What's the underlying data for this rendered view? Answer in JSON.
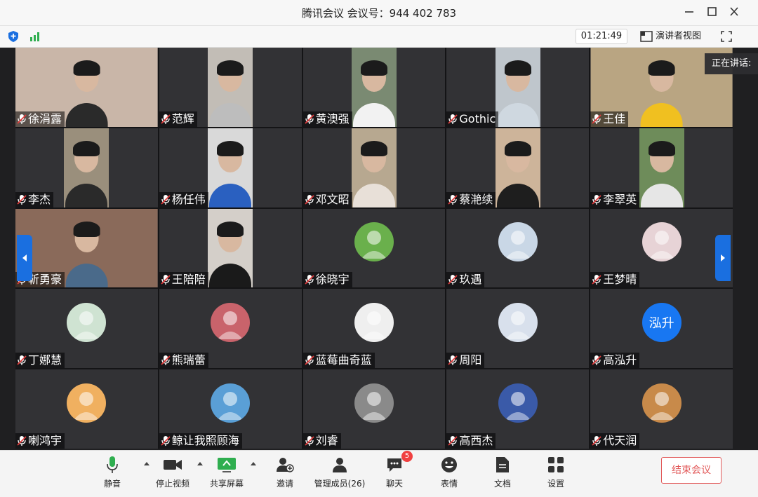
{
  "window": {
    "title": "腾讯会议 会议号：944 402 783",
    "timer": "01:21:49",
    "speaker_view": "演讲者视图",
    "speaking_tip": "正在讲话: "
  },
  "colors": {
    "accent": "#1a6fe0",
    "end": "#e25a5a",
    "badge": "#f04040"
  },
  "participants": [
    {
      "name": "徐涓露",
      "kind": "video",
      "wide": true,
      "bg": "#c9b6a8",
      "shirt": "#2a2a2a"
    },
    {
      "name": "范辉",
      "kind": "video",
      "bg": "#c2bdb6",
      "shirt": "#bdbdbd"
    },
    {
      "name": "黄澳强",
      "kind": "video",
      "bg": "#7a8a72",
      "shirt": "#f2f2f2"
    },
    {
      "name": "Gothic",
      "kind": "video",
      "bg": "#bfc6cc",
      "shirt": "#cfd8e0"
    },
    {
      "name": "王佳",
      "kind": "video",
      "wide": true,
      "bg": "#b9a582",
      "shirt": "#f0c020"
    },
    {
      "name": "李杰",
      "kind": "video",
      "bg": "#9a8f7c",
      "shirt": "#2a2a2a"
    },
    {
      "name": "杨任伟",
      "kind": "video",
      "bg": "#d9d9d9",
      "shirt": "#2a60c0"
    },
    {
      "name": "邓文昭",
      "kind": "video",
      "bg": "#b7a890",
      "shirt": "#e8e0d8"
    },
    {
      "name": "蔡滟续",
      "kind": "video",
      "bg": "#cdb49a",
      "shirt": "#1e1e1e"
    },
    {
      "name": "李翠英",
      "kind": "video",
      "bg": "#6e8c5a",
      "shirt": "#e6e6e6"
    },
    {
      "name": "靳勇豪",
      "kind": "video",
      "wide": true,
      "bg": "#8a6a5a",
      "shirt": "#4a6a8a"
    },
    {
      "name": "王陪陪",
      "kind": "video",
      "bg": "#d4cfc9",
      "shirt": "#1a1a1a"
    },
    {
      "name": "徐晓宇",
      "kind": "avatar",
      "avatar": "green-bird",
      "color": "#6ab04c"
    },
    {
      "name": "玖遇",
      "kind": "avatar",
      "avatar": "anime-girl",
      "color": "#c9d7e6"
    },
    {
      "name": "王梦晴",
      "kind": "avatar",
      "avatar": "anime-girl",
      "color": "#e7d3d6"
    },
    {
      "name": "丁娜慧",
      "kind": "avatar",
      "avatar": "illustration",
      "color": "#cfe3d2"
    },
    {
      "name": "熊瑞蕾",
      "kind": "avatar",
      "avatar": "pink-room",
      "color": "#c9636b"
    },
    {
      "name": "蓝莓曲奇蓝",
      "kind": "avatar",
      "avatar": "dog",
      "color": "#efefef"
    },
    {
      "name": "周阳",
      "kind": "avatar",
      "avatar": "anime-girl",
      "color": "#d8e0ec"
    },
    {
      "name": "高泓升",
      "kind": "avatar",
      "avatar": "text",
      "text": "泓升",
      "color": "#1877f2"
    },
    {
      "name": "喇鸿宇",
      "kind": "avatar",
      "avatar": "photo",
      "color": "#f0b060"
    },
    {
      "name": "鲸让我照顾海",
      "kind": "avatar",
      "avatar": "sea",
      "color": "#5a9fd6"
    },
    {
      "name": "刘睿",
      "kind": "avatar",
      "avatar": "street",
      "color": "#8a8a8a"
    },
    {
      "name": "高西杰",
      "kind": "avatar",
      "avatar": "anime-boy",
      "color": "#3a5aa8"
    },
    {
      "name": "代天润",
      "kind": "avatar",
      "avatar": "group",
      "color": "#c88a4a"
    }
  ],
  "toolbar": {
    "mute": "静音",
    "stop_video": "停止视频",
    "share_screen": "共享屏幕",
    "invite": "邀请",
    "manage_members": "管理成员(26)",
    "chat": "聊天",
    "chat_badge": "5",
    "emoji": "表情",
    "docs": "文档",
    "settings": "设置",
    "end_meeting": "结束会议"
  }
}
